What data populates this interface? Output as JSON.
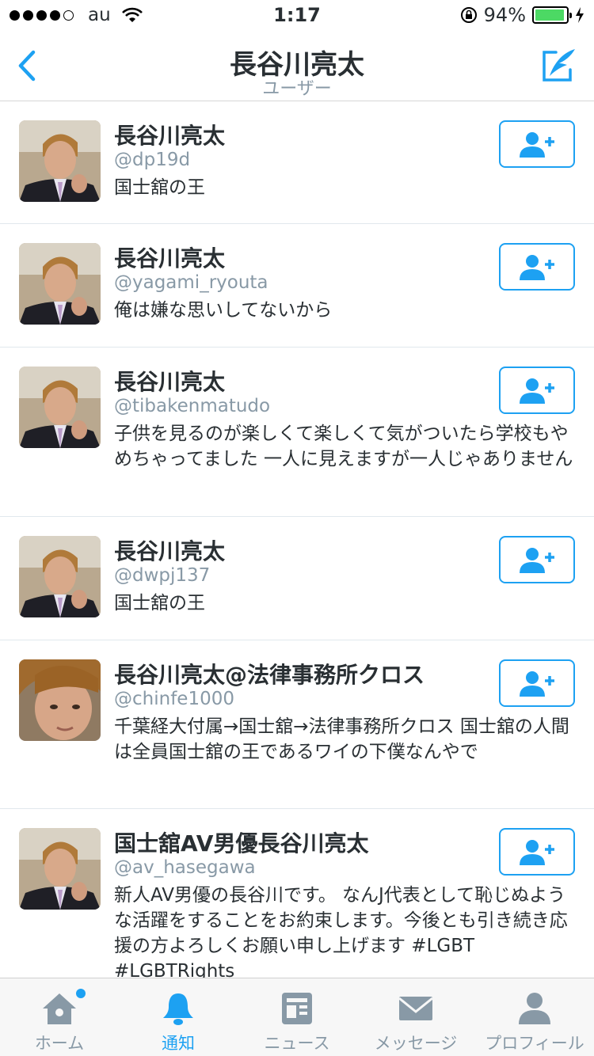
{
  "status_bar": {
    "carrier": "au",
    "time": "1:17",
    "battery_percent": "94%",
    "battery_level": 0.94,
    "signal_bars_filled": 4,
    "signal_bars_total": 5
  },
  "nav": {
    "title": "長谷川亮太",
    "subtitle": "ユーザー",
    "back_icon": "chevron-left-icon",
    "compose_icon": "compose-icon",
    "accent_color": "#1da1f2"
  },
  "users": [
    {
      "name": "長谷川亮太",
      "handle": "@dp19d",
      "bio": "国士舘の王"
    },
    {
      "name": "長谷川亮太",
      "handle": "@yagami_ryouta",
      "bio": "俺は嫌な思いしてないから"
    },
    {
      "name": "長谷川亮太",
      "handle": "@tibakenmatudo",
      "bio": "子供を見るのが楽しくて楽しくて気がついたら学校もやめちゃってました 一人に見えますが一人じゃありません"
    },
    {
      "name": "長谷川亮太",
      "handle": "@dwpj137",
      "bio": "国士舘の王"
    },
    {
      "name": "長谷川亮太@法律事務所クロス",
      "handle": "@chinfe1000",
      "bio": "千葉経大付属→国士舘→法律事務所クロス 国士舘の人間は全員国士舘の王であるワイの下僕なんやで"
    },
    {
      "name": "国士舘AV男優長谷川亮太",
      "handle": "@av_hasegawa",
      "bio": "新人AV男優の長谷川です。 なんJ代表として恥じぬような活躍をすることをお約束します。今後とも引き続き応援の方よろしくお願い申し上げます #LGBT #LGBTRights"
    }
  ],
  "tabs": [
    {
      "label": "ホーム",
      "icon": "home-icon",
      "has_badge": true
    },
    {
      "label": "通知",
      "icon": "bell-icon",
      "active": true
    },
    {
      "label": "ニュース",
      "icon": "news-icon"
    },
    {
      "label": "メッセージ",
      "icon": "envelope-icon"
    },
    {
      "label": "プロフィール",
      "icon": "profile-icon"
    }
  ]
}
